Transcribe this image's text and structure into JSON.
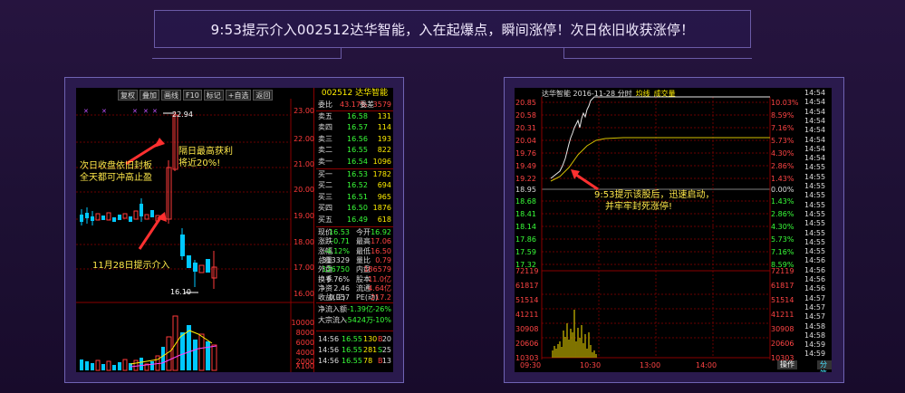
{
  "headline": "9:53提示介入002512达华智能，入在起爆点，瞬间涨停！次日依旧收获涨停！",
  "left": {
    "toolbar": [
      "复权",
      "叠加",
      "画线",
      "F10",
      "标记",
      "+自选",
      "返回"
    ],
    "stock_title": "002512 达华智能",
    "y_prices": [
      "23.00",
      "22.00",
      "21.00",
      "20.00",
      "19.00",
      "18.00",
      "17.00",
      "16.00"
    ],
    "vol_labels": [
      "10000",
      "8000",
      "6000",
      "4000",
      "2000",
      "X100"
    ],
    "high_label": "22.94",
    "low_label": "16.10",
    "annotations": {
      "a1": "次日收盘依旧封板",
      "a2": "全天都可冲高止盈",
      "a3": "隔日最高获利",
      "a4": "将近20%!",
      "a5": "11月28日提示介入"
    },
    "weibi": {
      "label": "委比",
      "val": "43.17%",
      "label2": "委差",
      "val2": "3579"
    },
    "sell": [
      {
        "label": "卖五",
        "price": "16.58",
        "vol": "131"
      },
      {
        "label": "卖四",
        "price": "16.57",
        "vol": "114"
      },
      {
        "label": "卖三",
        "price": "16.56",
        "vol": "193"
      },
      {
        "label": "卖二",
        "price": "16.55",
        "vol": "822"
      },
      {
        "label": "卖一",
        "price": "16.54",
        "vol": "1096"
      }
    ],
    "buy": [
      {
        "label": "买一",
        "price": "16.53",
        "vol": "1782"
      },
      {
        "label": "买二",
        "price": "16.52",
        "vol": "694"
      },
      {
        "label": "买三",
        "price": "16.51",
        "vol": "965"
      },
      {
        "label": "买四",
        "price": "16.50",
        "vol": "1876"
      },
      {
        "label": "买五",
        "price": "16.49",
        "vol": "618"
      }
    ],
    "stats": [
      {
        "l1": "现价",
        "v1": "16.53",
        "l2": "今开",
        "v2": "16.92"
      },
      {
        "l1": "涨跌",
        "v1": "-0.71",
        "l2": "最高",
        "v2": "17.06"
      },
      {
        "l1": "涨幅",
        "v1": "-4.12%",
        "l2": "最低",
        "v2": "16.50"
      },
      {
        "l1": "总量",
        "v1": "313329",
        "l2": "量比",
        "v2": "0.79"
      },
      {
        "l1": "外盘",
        "v1": "126750",
        "l2": "内盘",
        "v2": "186579"
      },
      {
        "l1": "换手",
        "v1": "6.76%",
        "l2": "股本",
        "v2": "11.0亿"
      },
      {
        "l1": "净资",
        "v1": "2.46",
        "l2": "流通",
        "v2": "4.64亿"
      },
      {
        "l1": "收益(三)",
        "v1": "0.057",
        "l2": "PE(动)",
        "v2": "217.2"
      }
    ],
    "flow": [
      {
        "l": "净流入额",
        "v": "-1.39亿",
        "p": "-26%"
      },
      {
        "l": "大宗流入",
        "v": "-5424万",
        "p": "-10%"
      }
    ],
    "ticks": [
      {
        "t": "14:56",
        "p": "16.55",
        "v": "130",
        "d": "B",
        "n": "20"
      },
      {
        "t": "14:56",
        "p": "16.55",
        "v": "281",
        "d": "S",
        "n": "25"
      },
      {
        "t": "14:56",
        "p": "16.55",
        "v": "78",
        "d": "B",
        "n": "13"
      }
    ]
  },
  "right": {
    "title": "达华智能  2016-11-28 分时",
    "legend1": "均线",
    "legend2": "成交量",
    "prices": [
      "20.85",
      "20.58",
      "20.31",
      "20.04",
      "19.76",
      "19.49",
      "19.22",
      "18.95",
      "18.68",
      "18.41",
      "18.14",
      "17.86",
      "17.59",
      "17.32"
    ],
    "pcts": [
      "10.03%",
      "8.59%",
      "7.16%",
      "5.73%",
      "4.30%",
      "2.86%",
      "1.43%",
      "0.00%",
      "1.43%",
      "2.86%",
      "4.30%",
      "5.73%",
      "7.16%",
      "8.59%"
    ],
    "vols": [
      "72119",
      "61817",
      "51514",
      "41211",
      "30908",
      "20606",
      "10303"
    ],
    "times_right": [
      "14:54",
      "14:54",
      "14:54",
      "14:54",
      "14:54",
      "14:54",
      "14:54",
      "14:54",
      "14:55",
      "14:55",
      "14:55",
      "14:55",
      "14:55",
      "14:55",
      "14:55",
      "14:55",
      "14:55",
      "14:55",
      "14:56",
      "14:56",
      "14:56",
      "14:56",
      "14:57",
      "14:57",
      "14:57",
      "14:58",
      "14:58",
      "14:59",
      "14:59"
    ],
    "xaxis": [
      "09:30",
      "10:30",
      "13:00",
      "14:00"
    ],
    "btn_op": "操作",
    "btn_tab": "分笔",
    "ann1": "9:53提示该股后，迅速启动，",
    "ann2": "并牢牢封死涨停!"
  }
}
